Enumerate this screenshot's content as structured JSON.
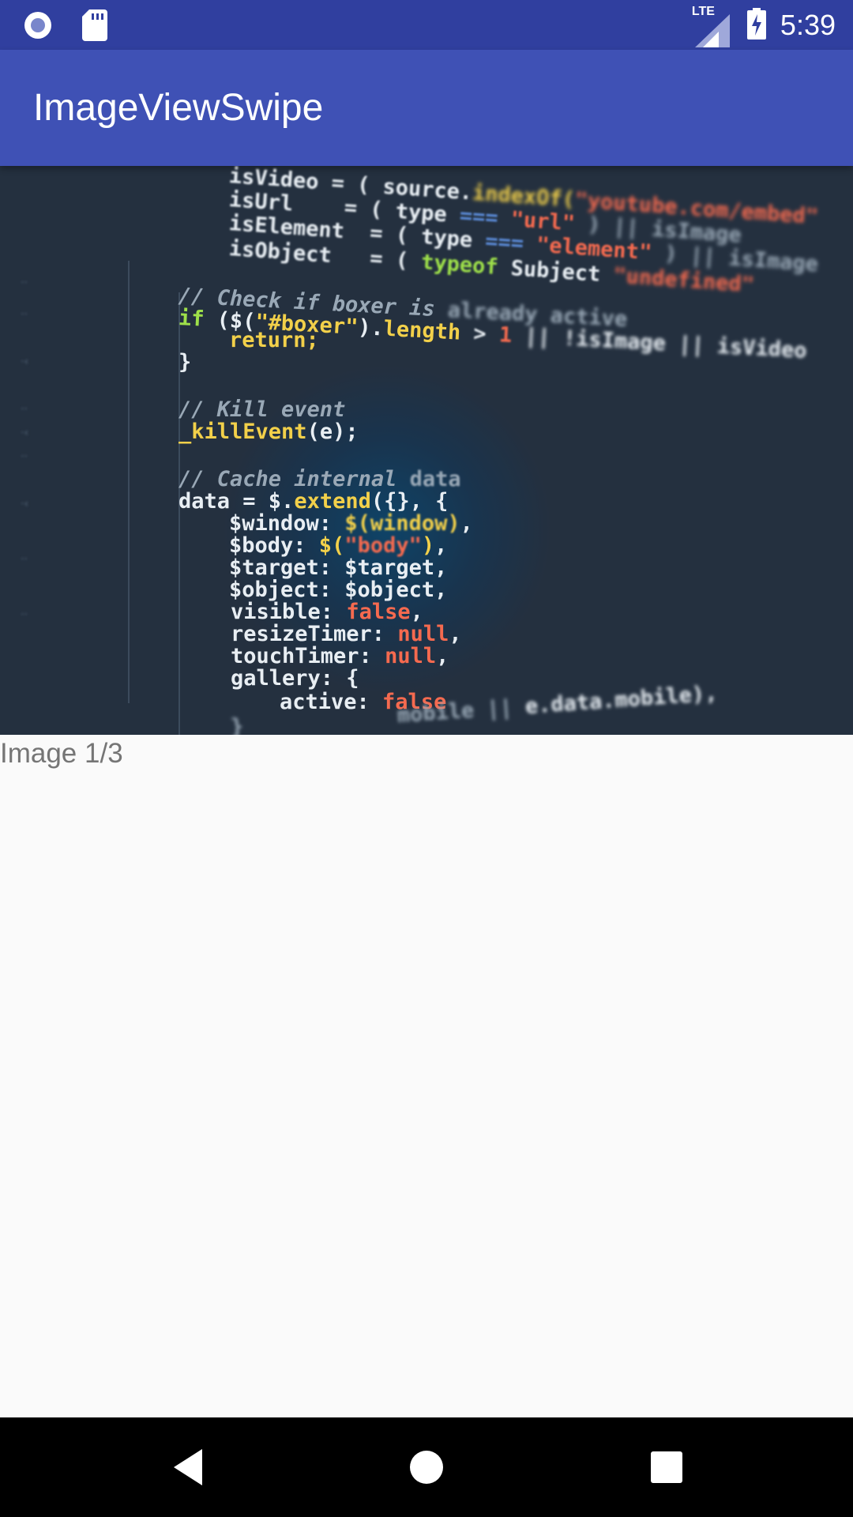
{
  "status_bar": {
    "time": "5:39",
    "network": "LTE",
    "icons": [
      "record-icon",
      "sd-card-icon",
      "signal-icon",
      "battery-charging-icon"
    ]
  },
  "app_bar": {
    "title": "ImageViewSwipe"
  },
  "viewer": {
    "image_description_icon": "code-screenshot-image",
    "caption": "Image 1/3"
  },
  "nav_bar": {
    "icons": [
      "back-icon",
      "home-icon",
      "recents-icon"
    ]
  },
  "colors": {
    "status_bar": "#303f9f",
    "app_bar": "#3f51b5",
    "background": "#fafafa",
    "caption_text": "#757575",
    "image_bg": "#24303f"
  }
}
